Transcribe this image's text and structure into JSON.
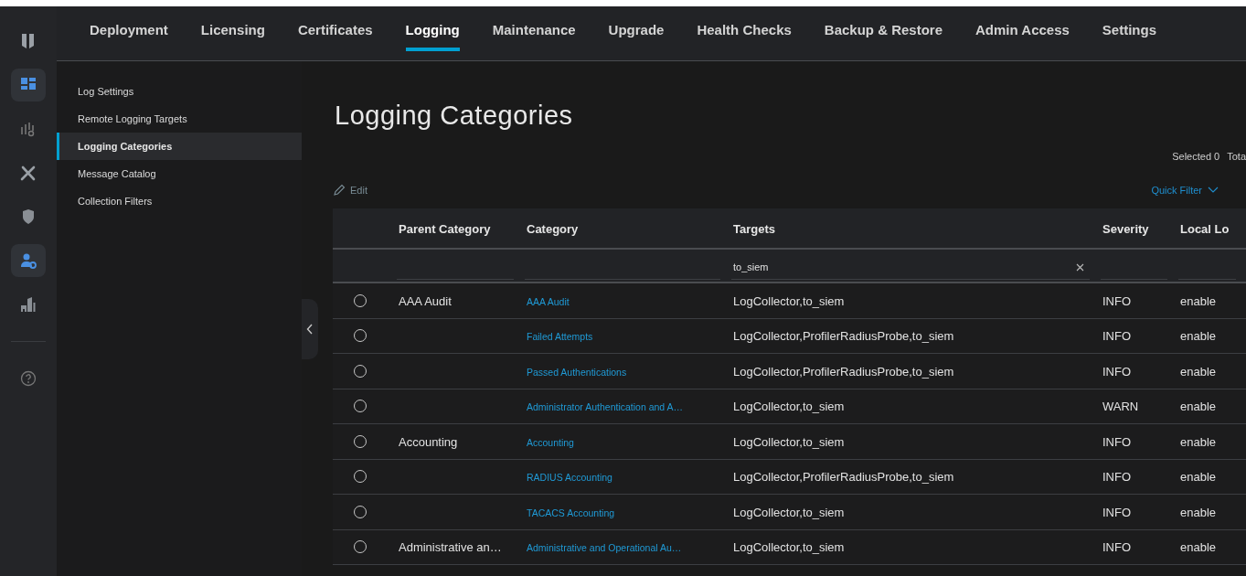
{
  "rail": [
    {
      "selected": false
    },
    {
      "selected": true
    },
    {
      "selected": false
    },
    {
      "selected": false
    },
    {
      "selected": false
    },
    {
      "selected": true
    },
    {
      "selected": false
    },
    {
      "selected": false
    }
  ],
  "tabs": [
    {
      "label": "Deployment",
      "selected": false
    },
    {
      "label": "Licensing",
      "selected": false
    },
    {
      "label": "Certificates",
      "selected": false
    },
    {
      "label": "Logging",
      "selected": true
    },
    {
      "label": "Maintenance",
      "selected": false
    },
    {
      "label": "Upgrade",
      "selected": false
    },
    {
      "label": "Health Checks",
      "selected": false
    },
    {
      "label": "Backup & Restore",
      "selected": false
    },
    {
      "label": "Admin Access",
      "selected": false
    },
    {
      "label": "Settings",
      "selected": false
    }
  ],
  "sidebar": {
    "items": [
      {
        "label": "Log Settings",
        "selected": false
      },
      {
        "label": "Remote Logging Targets",
        "selected": false
      },
      {
        "label": "Logging Categories",
        "selected": true
      },
      {
        "label": "Message Catalog",
        "selected": false
      },
      {
        "label": "Collection Filters",
        "selected": false
      }
    ]
  },
  "page_title": "Logging Categories",
  "selection_summary": {
    "selected": "Selected 0",
    "total": "Tota"
  },
  "toolbar": {
    "edit": "Edit",
    "quick_filter": "Quick Filter"
  },
  "table": {
    "columns": [
      "Parent Category",
      "Category",
      "Targets",
      "Severity",
      "Local Lo"
    ],
    "targets_filter": "to_siem",
    "rows": [
      {
        "selected": false,
        "parent": "AAA Audit",
        "category": "AAA Audit",
        "targets": "LogCollector,to_siem",
        "severity": "INFO",
        "local_log": "enable"
      },
      {
        "selected": false,
        "parent": "",
        "category": "Failed Attempts",
        "targets": "LogCollector,ProfilerRadiusProbe,to_siem",
        "severity": "INFO",
        "local_log": "enable"
      },
      {
        "selected": false,
        "parent": "",
        "category": "Passed Authentications",
        "targets": "LogCollector,ProfilerRadiusProbe,to_siem",
        "severity": "INFO",
        "local_log": "enable"
      },
      {
        "selected": false,
        "parent": "",
        "category": "Administrator Authentication and A…",
        "targets": "LogCollector,to_siem",
        "severity": "WARN",
        "local_log": "enable"
      },
      {
        "selected": false,
        "parent": "Accounting",
        "category": "Accounting",
        "targets": "LogCollector,to_siem",
        "severity": "INFO",
        "local_log": "enable"
      },
      {
        "selected": false,
        "parent": "",
        "category": "RADIUS Accounting",
        "targets": "LogCollector,ProfilerRadiusProbe,to_siem",
        "severity": "INFO",
        "local_log": "enable"
      },
      {
        "selected": false,
        "parent": "",
        "category": "TACACS Accounting",
        "targets": "LogCollector,to_siem",
        "severity": "INFO",
        "local_log": "enable"
      },
      {
        "selected": false,
        "parent": "Administrative an…",
        "category": "Administrative and Operational Au…",
        "targets": "LogCollector,to_siem",
        "severity": "INFO",
        "local_log": "enable"
      }
    ]
  }
}
